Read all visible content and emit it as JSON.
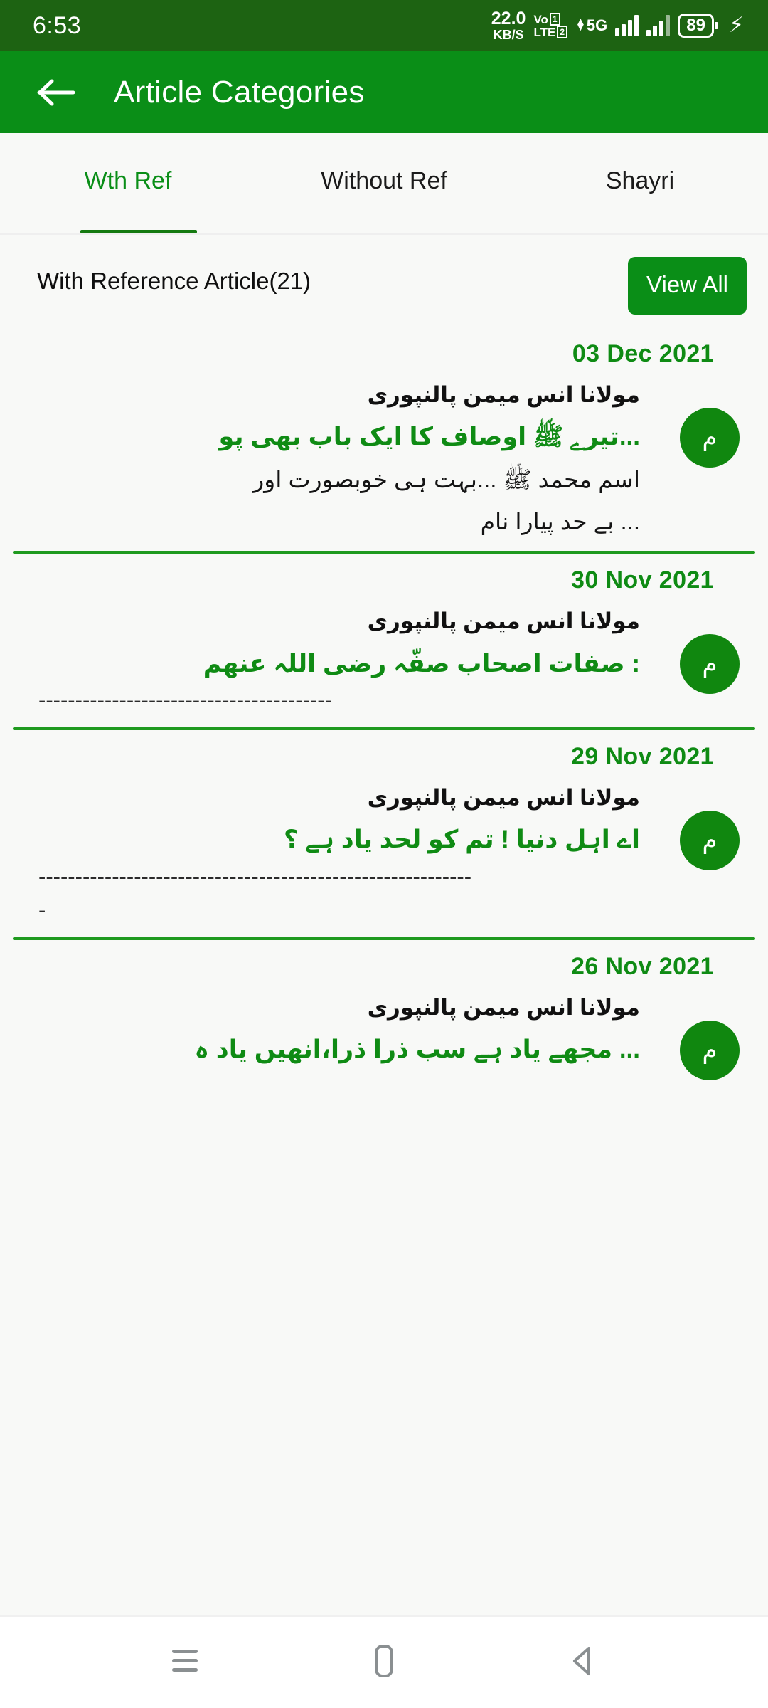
{
  "statusbar": {
    "clock": "6:53",
    "net_speed_value": "22.0",
    "net_speed_unit": "KB/S",
    "volte_line1": "VoD",
    "volte_vo": "Vo",
    "volte_sim1": "1",
    "volte_lte": "LTE",
    "volte_sim2": "2",
    "network_type": "5G",
    "battery_percent": "89",
    "icons": {
      "signal1": "signal-bars-icon",
      "signal2": "signal-bars-icon",
      "battery": "battery-icon",
      "charging": "charging-bolt-icon"
    }
  },
  "appbar": {
    "back_icon": "arrow-left-icon",
    "title": "Article Categories"
  },
  "tabs": [
    {
      "label": "Wth Ref",
      "active": true
    },
    {
      "label": "Without Ref",
      "active": false
    },
    {
      "label": "Shayri",
      "active": false
    }
  ],
  "section": {
    "title": "With Reference Article(21)",
    "view_all_label": "View All"
  },
  "colors": {
    "status_bar": "#1d6312",
    "app_bar": "#0a8e17",
    "accent_green": "#0f8b14",
    "page_background": "#f8f9f7",
    "divider_green": "#1f9a1f"
  },
  "articles": [
    {
      "date": "03 Dec 2021",
      "avatar_letter": "م",
      "author": "مولانا انس میمن پالنپوری",
      "headline": "...تیرے ﷺ اوصاف کا ایک باب بھی پو",
      "excerpt_line1": "اسم محمد ﷺ ...بہت ہی خوبصورت اور",
      "excerpt_line2": "... بے حد پیارا نام",
      "dashes": ""
    },
    {
      "date": "30 Nov 2021",
      "avatar_letter": "م",
      "author": "مولانا انس میمن پالنپوری",
      "headline": ": صفات اصحاب صفّہ رضی اللہ عنھم",
      "excerpt_line1": "",
      "excerpt_line2": "",
      "dashes": "----------------------------------------"
    },
    {
      "date": "29 Nov 2021",
      "avatar_letter": "م",
      "author": "مولانا انس میمن پالنپوری",
      "headline": "اے اہل دنیا ! تم کو لحد یاد ہے ؟",
      "excerpt_line1": "",
      "excerpt_line2": "",
      "dashes": "-----------------------------------------------------------",
      "dashes_overflow": "-"
    },
    {
      "date": "26 Nov 2021",
      "avatar_letter": "م",
      "author": "مولانا انس میمن پالنپوری",
      "headline": "... مجھے یاد ہے سب ذرا ذرا،انھیں یاد ہ",
      "excerpt_line1": "",
      "excerpt_line2": "",
      "dashes": ""
    }
  ],
  "navbar": {
    "recents_icon": "menu-recents-icon",
    "home_icon": "home-pill-icon",
    "back_icon": "back-triangle-icon"
  }
}
